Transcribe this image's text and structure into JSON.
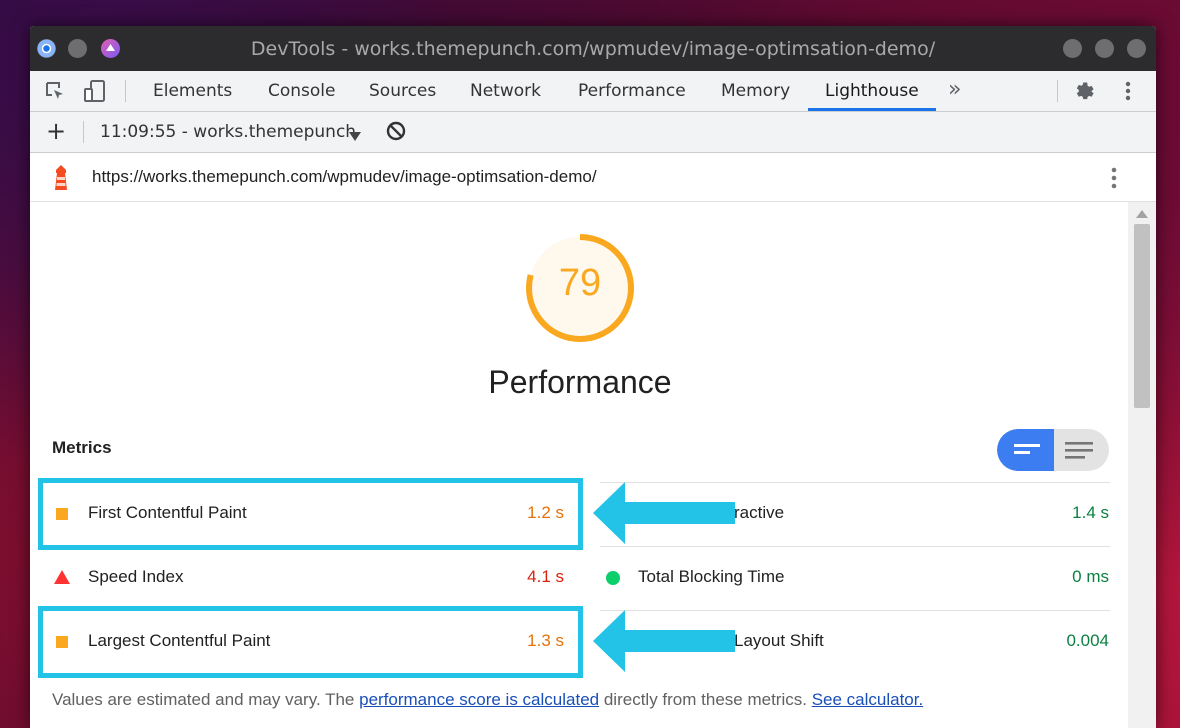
{
  "window": {
    "title": "DevTools - works.themepunch.com/wpmudev/image-optimsation-demo/"
  },
  "toolbar": {
    "tabs": [
      "Elements",
      "Console",
      "Sources",
      "Network",
      "Performance",
      "Memory",
      "Lighthouse"
    ],
    "active_tab": "Lighthouse",
    "more_label": "»"
  },
  "subbar": {
    "report_label": "11:09:55 - works.themepunch",
    "add_label": "+"
  },
  "urlbar": {
    "url": "https://works.themepunch.com/wpmudev/image-optimsation-demo/"
  },
  "report": {
    "score": "79",
    "category": "Performance",
    "metrics_heading": "Metrics",
    "metrics_left": [
      {
        "label": "First Contentful Paint",
        "value": "1.2 s",
        "status": "average"
      },
      {
        "label": "Speed Index",
        "value": "4.1 s",
        "status": "fail"
      },
      {
        "label": "Largest Contentful Paint",
        "value": "1.3 s",
        "status": "average"
      }
    ],
    "metrics_right": [
      {
        "label": "ractive",
        "value": "1.4 s",
        "status": "pass"
      },
      {
        "label": "Total Blocking Time",
        "value": "0 ms",
        "status": "pass"
      },
      {
        "label": "Layout Shift",
        "value": "0.004",
        "status": "pass"
      }
    ],
    "footnote_prefix": "Values are estimated and may vary. The ",
    "footnote_link1": "performance score is calculated",
    "footnote_middle": " directly from these metrics. ",
    "footnote_link2": "See calculator."
  },
  "colors": {
    "score_orange": "#f9a81f",
    "fail_red": "#f33",
    "average_text": "#e8710a",
    "pass_green": "#0b8043",
    "highlight_cyan": "#22c3e6",
    "accent_blue": "#1a73e8"
  }
}
